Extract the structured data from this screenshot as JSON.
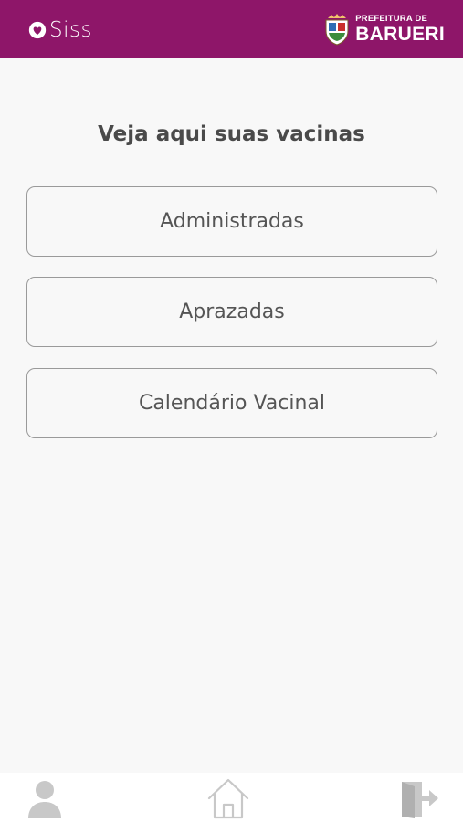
{
  "header": {
    "app_name": "Siss",
    "logo_line1": "PREFEITURA DE",
    "logo_line2": "BARUERI",
    "background_color": "#8e1669"
  },
  "main": {
    "title": "Veja aqui suas vacinas",
    "options": [
      {
        "label": "Administradas"
      },
      {
        "label": "Aprazadas"
      },
      {
        "label": "Calendário Vacinal"
      }
    ]
  },
  "bottom_nav": {
    "items": [
      {
        "icon": "user-icon"
      },
      {
        "icon": "home-icon"
      },
      {
        "icon": "logout-icon"
      }
    ],
    "icon_color": "#c8c8c8"
  }
}
